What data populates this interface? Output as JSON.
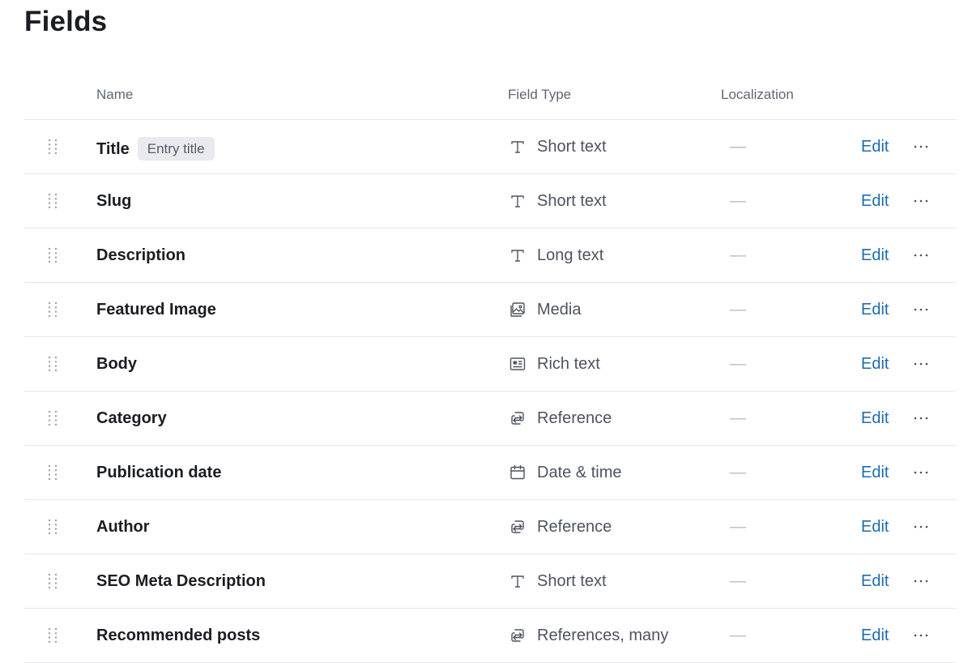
{
  "page": {
    "title": "Fields"
  },
  "columns": {
    "name": "Name",
    "field_type": "Field Type",
    "localization": "Localization"
  },
  "colors": {
    "link": "#1d6bb0",
    "badge_bg": "#e8eaee",
    "text_primary": "#1b1d22",
    "text_muted": "#5f6673",
    "divider": "#e5e7eb"
  },
  "fields": [
    {
      "name": "Title",
      "badge": "Entry title",
      "type": "Short text",
      "type_icon": "text-icon",
      "localization": "—",
      "edit_label": "Edit",
      "more_icon": "more-horizontal-icon"
    },
    {
      "name": "Slug",
      "badge": "",
      "type": "Short text",
      "type_icon": "text-icon",
      "localization": "—",
      "edit_label": "Edit",
      "more_icon": "more-horizontal-icon"
    },
    {
      "name": "Description",
      "badge": "",
      "type": "Long text",
      "type_icon": "text-icon",
      "localization": "—",
      "edit_label": "Edit",
      "more_icon": "more-horizontal-icon"
    },
    {
      "name": "Featured Image",
      "badge": "",
      "type": "Media",
      "type_icon": "media-icon",
      "localization": "—",
      "edit_label": "Edit",
      "more_icon": "more-horizontal-icon"
    },
    {
      "name": "Body",
      "badge": "",
      "type": "Rich text",
      "type_icon": "rich-text-icon",
      "localization": "—",
      "edit_label": "Edit",
      "more_icon": "more-horizontal-icon"
    },
    {
      "name": "Category",
      "badge": "",
      "type": "Reference",
      "type_icon": "reference-icon",
      "localization": "—",
      "edit_label": "Edit",
      "more_icon": "more-horizontal-icon"
    },
    {
      "name": "Publication date",
      "badge": "",
      "type": "Date & time",
      "type_icon": "calendar-icon",
      "localization": "—",
      "edit_label": "Edit",
      "more_icon": "more-horizontal-icon"
    },
    {
      "name": "Author",
      "badge": "",
      "type": "Reference",
      "type_icon": "reference-icon",
      "localization": "—",
      "edit_label": "Edit",
      "more_icon": "more-horizontal-icon"
    },
    {
      "name": "SEO Meta Description",
      "badge": "",
      "type": "Short text",
      "type_icon": "text-icon",
      "localization": "—",
      "edit_label": "Edit",
      "more_icon": "more-horizontal-icon"
    },
    {
      "name": "Recommended posts",
      "badge": "",
      "type": "References, many",
      "type_icon": "reference-icon",
      "localization": "—",
      "edit_label": "Edit",
      "more_icon": "more-horizontal-icon"
    }
  ]
}
